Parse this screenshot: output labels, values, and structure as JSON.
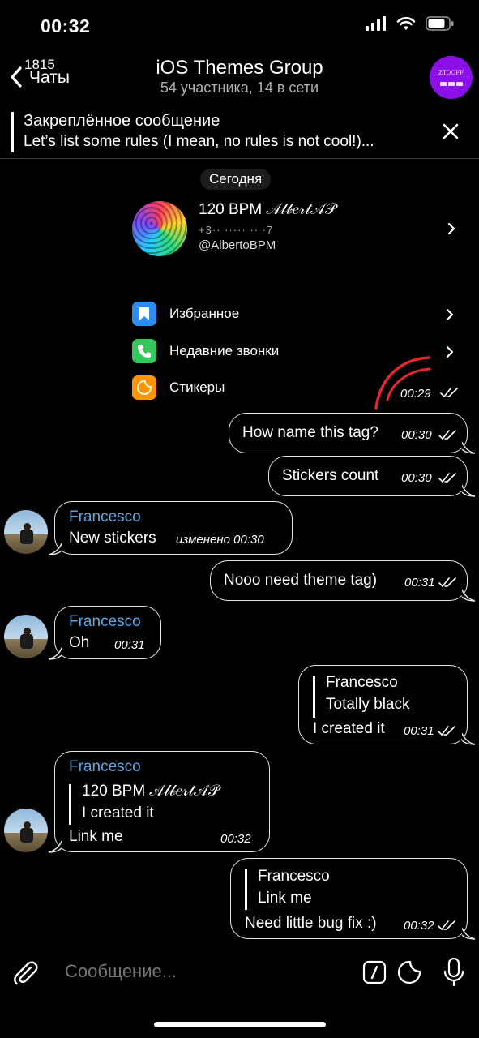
{
  "status_bar": {
    "time": "00:32",
    "signal_icon": "cellular-signal-icon",
    "wifi_icon": "wifi-icon",
    "battery_icon": "battery-icon"
  },
  "header": {
    "back_count": "1815",
    "back_label": "Чаты",
    "title": "iOS Themes Group",
    "subtitle": "54 участника, 14 в сети",
    "avatar_text": "ZTOOFF"
  },
  "pinned": {
    "title": "Закреплённое сообщение",
    "text": "Let’s list some rules (I mean, no rules is not cool!)..."
  },
  "date_separator": "Сегодня",
  "profile_card": {
    "name": "120 BPM 𝒜𝓁𝒷𝑒𝓇𝓉𝒜𝒫",
    "phone": "+3·· ····· ·· ·7",
    "handle": "@AlbertoBPM",
    "menu": [
      {
        "label": "Избранное",
        "icon": "bookmark-icon",
        "color": "#2d8cf0"
      },
      {
        "label": "Недавние звонки",
        "icon": "phone-icon",
        "color": "#34c759"
      },
      {
        "label": "Стикеры",
        "icon": "sticker-icon",
        "color": "#ff9500"
      }
    ],
    "time": "00:29"
  },
  "messages": [
    {
      "direction": "out",
      "text": "How name this tag?",
      "time": "00:30"
    },
    {
      "direction": "out",
      "text": "Stickers count",
      "time": "00:30"
    },
    {
      "direction": "in",
      "sender": "Francesco",
      "text": "New stickers",
      "time": "изменено 00:30"
    },
    {
      "direction": "out",
      "text": "Nooo need theme tag)",
      "time": "00:31"
    },
    {
      "direction": "in",
      "sender": "Francesco",
      "text": "Oh",
      "time": "00:31"
    },
    {
      "direction": "out",
      "reply_author": "Francesco",
      "reply_text": "Totally black",
      "text": "I created it",
      "time": "00:31"
    },
    {
      "direction": "in",
      "sender": "Francesco",
      "reply_author": "120 BPM 𝒜𝓁𝒷𝑒𝓇𝓉𝒜𝒫",
      "reply_text": "I created it",
      "text": "Link me",
      "time": "00:32"
    },
    {
      "direction": "out",
      "reply_author": "Francesco",
      "reply_text": "Link me",
      "text": "Need little bug fix :)",
      "time": "00:32"
    }
  ],
  "composer": {
    "placeholder": "Сообщение...",
    "attach_icon": "paperclip-icon",
    "command_icon": "slash-command-icon",
    "sticker_icon": "sticker-icon",
    "mic_icon": "microphone-icon"
  },
  "colors": {
    "background": "#000000",
    "sender_name": "#5aa7e6",
    "bubble_border": "#e6e6e6",
    "annotation": "#e3262f"
  }
}
